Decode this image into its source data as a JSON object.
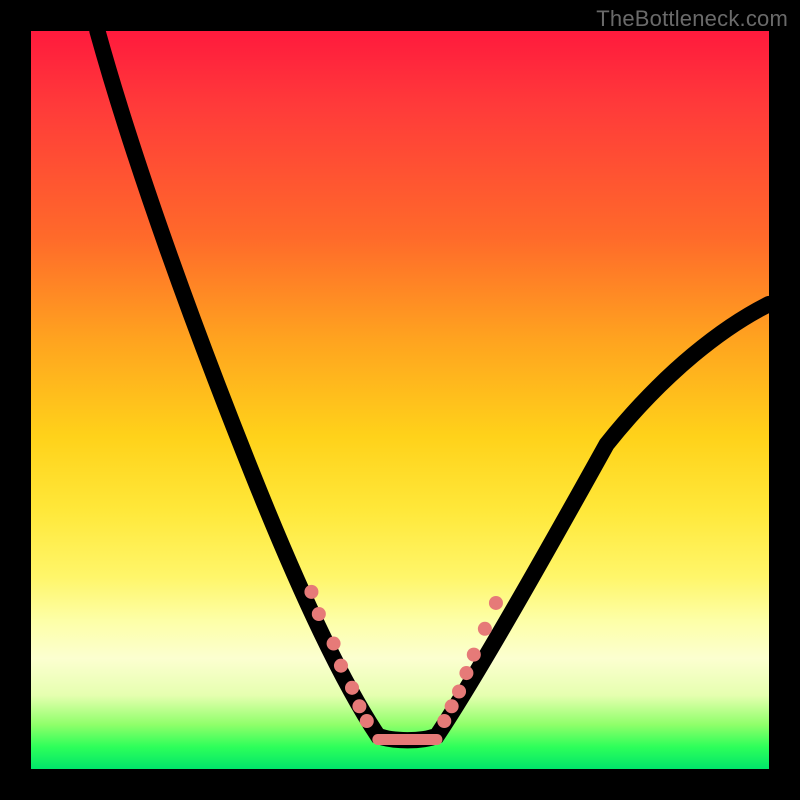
{
  "watermark": "TheBottleneck.com",
  "chart_data": {
    "type": "line",
    "title": "",
    "xlabel": "",
    "ylabel": "",
    "xlim": [
      0,
      100
    ],
    "ylim": [
      0,
      100
    ],
    "grid": false,
    "legend": false,
    "series": [
      {
        "name": "bottleneck-curve",
        "x": [
          9,
          12,
          16,
          20,
          24,
          28,
          32,
          36,
          40,
          43,
          45,
          47,
          49,
          51,
          54,
          57,
          60,
          65,
          70,
          75,
          80,
          85,
          90,
          95,
          100
        ],
        "y": [
          100,
          88,
          74,
          62,
          51,
          41,
          33,
          25,
          18,
          12,
          8,
          5,
          4,
          4,
          4,
          5,
          8,
          14,
          22,
          30,
          38,
          45,
          52,
          58,
          63
        ]
      }
    ],
    "highlight_points_left": [
      [
        38,
        24
      ],
      [
        39,
        21
      ],
      [
        41,
        17
      ],
      [
        42,
        14
      ],
      [
        43.5,
        11
      ],
      [
        44.5,
        8.5
      ],
      [
        45.5,
        6.5
      ]
    ],
    "highlight_points_right": [
      [
        56,
        6.5
      ],
      [
        57,
        8.5
      ],
      [
        58,
        10.5
      ],
      [
        59,
        13
      ],
      [
        60,
        15.5
      ],
      [
        61.5,
        19
      ],
      [
        63,
        22.5
      ]
    ],
    "flat_segment": {
      "x_start": 47,
      "x_end": 55,
      "y": 4
    }
  },
  "colors": {
    "gradient_top": "#ff1a3d",
    "gradient_mid": "#ffe83a",
    "gradient_bottom": "#00e56a",
    "curve": "#000000",
    "dots": "#e67a78",
    "frame": "#000000",
    "watermark": "#6a6a6a"
  }
}
